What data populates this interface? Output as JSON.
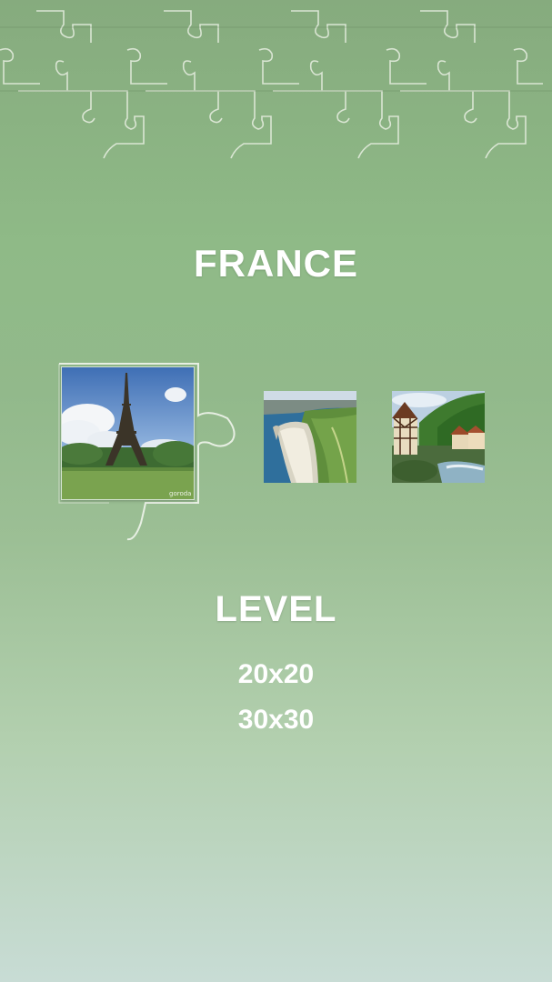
{
  "category_title": "FRANCE",
  "level_title": "LEVEL",
  "levels": [
    "20x20",
    "30x30"
  ],
  "thumbnails": [
    {
      "name": "eiffel-tower",
      "watermark": "goroda",
      "selected": true
    },
    {
      "name": "etretat-cliffs",
      "selected": false
    },
    {
      "name": "alsace-village",
      "selected": false
    }
  ]
}
